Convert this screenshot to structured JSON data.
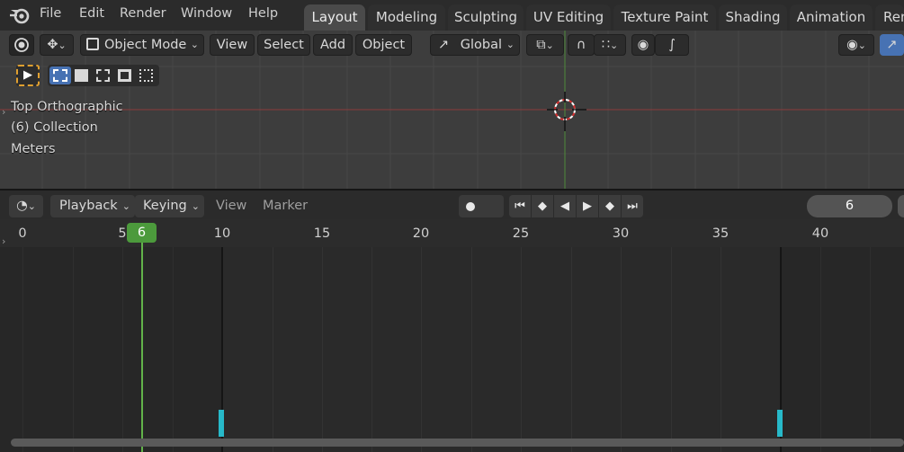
{
  "menu": [
    "File",
    "Edit",
    "Render",
    "Window",
    "Help"
  ],
  "workspaces": [
    "Layout",
    "Modeling",
    "Sculpting",
    "UV Editing",
    "Texture Paint",
    "Shading",
    "Animation",
    "Ren"
  ],
  "active_workspace": "Layout",
  "viewport": {
    "mode": "Object Mode",
    "menus": [
      "View",
      "Select",
      "Add",
      "Object"
    ],
    "orientation": "Global",
    "overlay_lines": [
      "Top Orthographic",
      "(6) Collection",
      "Meters"
    ]
  },
  "timeline": {
    "menus": [
      "Playback",
      "Keying"
    ],
    "plain_menus": [
      "View",
      "Marker"
    ],
    "current_frame": "6",
    "ruler_ticks": [
      "0",
      "5",
      "10",
      "15",
      "20",
      "25",
      "30",
      "35",
      "40"
    ],
    "playhead_label": "6",
    "keyframes": [
      10,
      38
    ],
    "range_marks": [
      10,
      38
    ]
  },
  "colors": {
    "keyframe": "#27b9c9",
    "playhead": "#4c9a3c",
    "x_axis": "#8b3b3b",
    "y_axis": "#4f8b3a",
    "active_tab": "#4a4a4a"
  }
}
